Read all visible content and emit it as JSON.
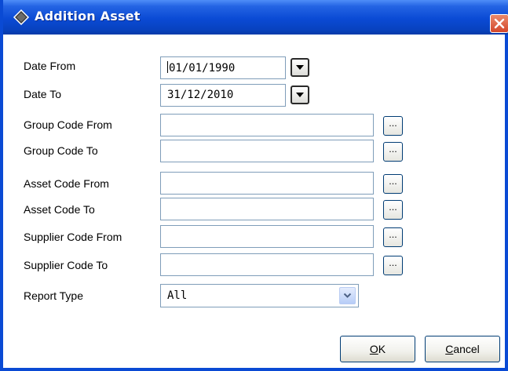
{
  "window": {
    "title": "Addition Asset",
    "icon": "diamond-icon",
    "close_icon": "close-icon",
    "accent_color": "#0a4ad4"
  },
  "form": {
    "date_from": {
      "label": "Date From",
      "value": "01/01/1990"
    },
    "date_to": {
      "label": "Date To",
      "value": "31/12/2010"
    },
    "group_code_from": {
      "label": "Group Code From",
      "value": ""
    },
    "group_code_to": {
      "label": "Group Code To",
      "value": ""
    },
    "asset_code_from": {
      "label": "Asset Code From",
      "value": ""
    },
    "asset_code_to": {
      "label": "Asset Code To",
      "value": ""
    },
    "supplier_code_from": {
      "label": "Supplier Code From",
      "value": ""
    },
    "supplier_code_to": {
      "label": "Supplier Code To",
      "value": ""
    },
    "report_type": {
      "label": "Report Type",
      "selected": "All"
    },
    "browse_label": "..."
  },
  "buttons": {
    "ok": {
      "accel": "O",
      "rest": "K"
    },
    "cancel": {
      "accel": "C",
      "rest": "ancel"
    }
  }
}
